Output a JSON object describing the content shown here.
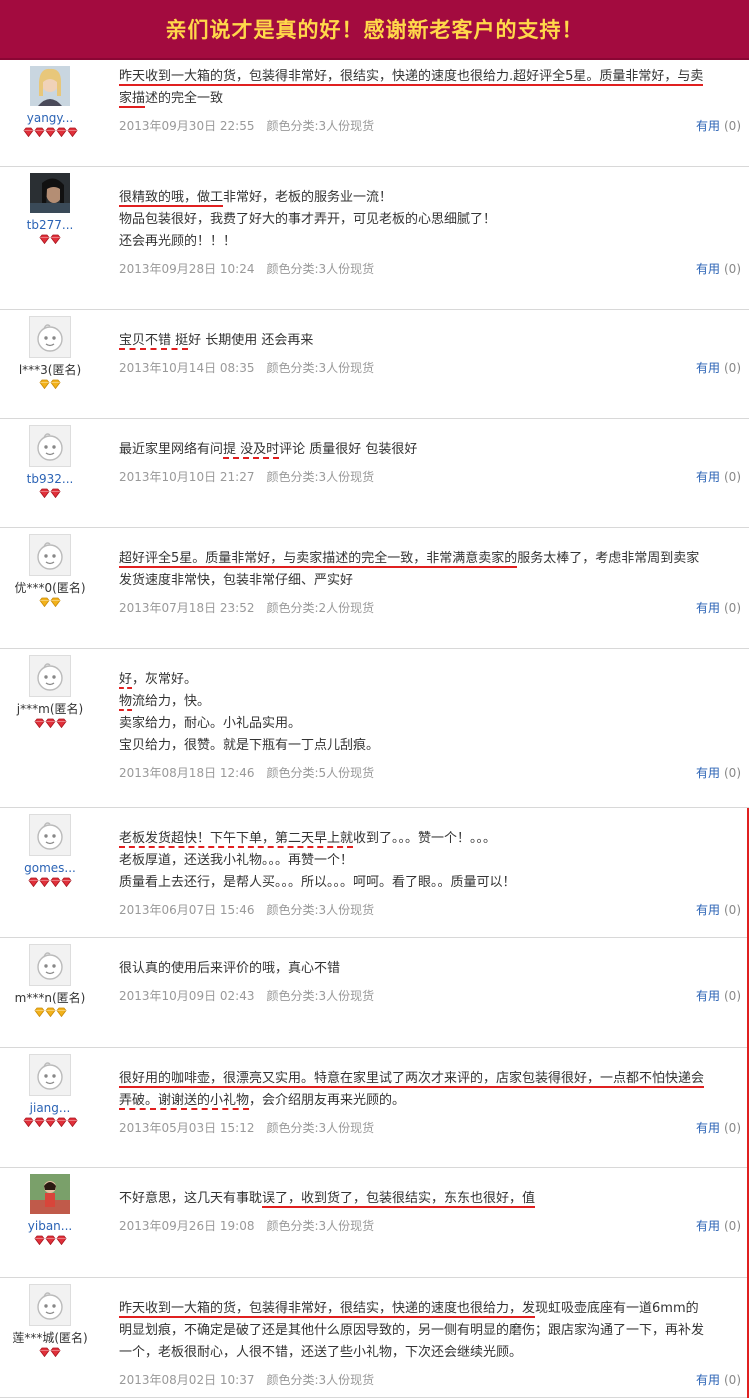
{
  "banner": {
    "title": "亲们说才是真的好！感谢新老客户的支持！"
  },
  "useful_label": "有用",
  "reviews": [
    {
      "user": "yangy...",
      "user_style": "blue",
      "avatar": "photo-woman",
      "rank": "red",
      "rank_count": 5,
      "lines": [
        "昨天收到一大箱的货，包装得非常好，很结实，快递的速度也很给力.超好评全5星。质量非常好，与卖",
        "家描述的完全一致"
      ],
      "date": "2013年09月30日 22:55",
      "spec": "颜色分类:3人份现货",
      "useful_count": "(0)"
    },
    {
      "user": "tb277...",
      "user_style": "blue",
      "avatar": "photo-dark",
      "rank": "red",
      "rank_count": 2,
      "lines": [
        "很精致的哦，做工非常好，老板的服务业一流！",
        "物品包装很好，我费了好大的事才弄开，可见老板的心思细腻了！",
        "还会再光顾的！！！"
      ],
      "date": "2013年09月28日 10:24",
      "spec": "颜色分类:3人份现货",
      "useful_count": "(0)"
    },
    {
      "user": "l***3(匿名)",
      "user_style": "dark",
      "avatar": "default",
      "rank": "yellow",
      "rank_count": 2,
      "lines": [
        "宝贝不错 挺好 长期使用 还会再来"
      ],
      "date": "2013年10月14日 08:35",
      "spec": "颜色分类:3人份现货",
      "useful_count": "(0)"
    },
    {
      "user": "tb932...",
      "user_style": "blue",
      "avatar": "default",
      "rank": "red",
      "rank_count": 2,
      "lines": [
        "最近家里网络有问提 没及时评论 质量很好 包装很好"
      ],
      "date": "2013年10月10日 21:27",
      "spec": "颜色分类:3人份现货",
      "useful_count": "(0)"
    },
    {
      "user": "优***0(匿名)",
      "user_style": "dark",
      "avatar": "default",
      "rank": "yellow",
      "rank_count": 2,
      "lines": [
        "超好评全5星。质量非常好，与卖家描述的完全一致，非常满意卖家的服务太棒了，考虑非常周到卖家",
        "发货速度非常快，包装非常仔细、严实好"
      ],
      "date": "2013年07月18日 23:52",
      "spec": "颜色分类:2人份现货",
      "useful_count": "(0)"
    },
    {
      "user": "j***m(匿名)",
      "user_style": "dark",
      "avatar": "default",
      "rank": "red",
      "rank_count": 3,
      "lines": [
        "好，灰常好。",
        "物流给力，快。",
        "卖家给力，耐心。小礼品实用。",
        "宝贝给力，很赞。就是下瓶有一丁点儿刮痕。"
      ],
      "date": "2013年08月18日 12:46",
      "spec": "颜色分类:5人份现货",
      "useful_count": "(0)"
    },
    {
      "user": "gomes...",
      "user_style": "blue",
      "avatar": "default",
      "rank": "red",
      "rank_count": 4,
      "lines": [
        "老板发货超快！下午下单，第二天早上就收到了。。。赞一个！。。。",
        "老板厚道，还送我小礼物。。。再赞一个！",
        "质量看上去还行，是帮人买。。。所以。。。呵呵。看了眼。。质量可以！"
      ],
      "date": "2013年06月07日 15:46",
      "spec": "颜色分类:3人份现货",
      "useful_count": "(0)"
    },
    {
      "user": "m***n(匿名)",
      "user_style": "dark",
      "avatar": "default",
      "rank": "yellow",
      "rank_count": 3,
      "lines": [
        "很认真的使用后来评价的哦，真心不错"
      ],
      "date": "2013年10月09日 02:43",
      "spec": "颜色分类:3人份现货",
      "useful_count": "(0)"
    },
    {
      "user": "jiang...",
      "user_style": "blue",
      "avatar": "default",
      "rank": "red",
      "rank_count": 5,
      "lines": [
        "很好用的咖啡壶，很漂亮又实用。特意在家里试了两次才来评的，店家包装得很好，一点都不怕快递会",
        "弄破。谢谢送的小礼物，会介绍朋友再来光顾的。"
      ],
      "date": "2013年05月03日 15:12",
      "spec": "颜色分类:3人份现货",
      "useful_count": "(0)"
    },
    {
      "user": "yiban...",
      "user_style": "blue",
      "avatar": "photo-girl",
      "rank": "red",
      "rank_count": 3,
      "lines": [
        "不好意思，这几天有事耽误了，收到货了，包装很结实，东东也很好，值"
      ],
      "date": "2013年09月26日 19:08",
      "spec": "颜色分类:3人份现货",
      "useful_count": "(0)"
    },
    {
      "user": "莲***城(匿名)",
      "user_style": "dark",
      "avatar": "default",
      "rank": "red",
      "rank_count": 2,
      "lines": [
        "昨天收到一大箱的货，包装得非常好，很结实，快递的速度也很给力，发现虹吸壶底座有一道6mm的",
        "明显划痕，不确定是破了还是其他什么原因导致的，另一侧有明显的磨伤；跟店家沟通了一下，再补发",
        "一个，老板很耐心，人很不错，还送了些小礼物，下次还会继续光顾。"
      ],
      "date": "2013年08月02日 10:37",
      "spec": "颜色分类:3人份现货",
      "useful_count": "(0)"
    }
  ]
}
